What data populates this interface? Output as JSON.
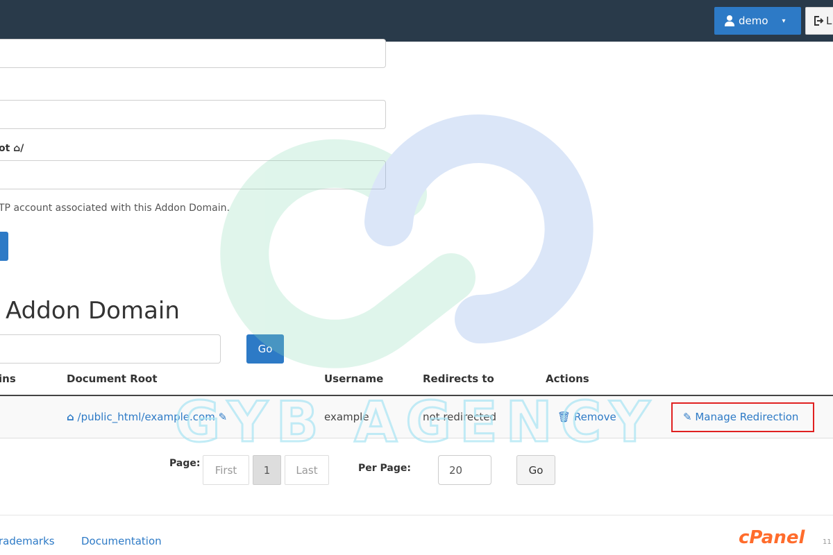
{
  "header": {
    "user_label": "demo",
    "user_caret": "▾",
    "logout_label": "L"
  },
  "form": {
    "doc_root_label": "ot",
    "doc_root_suffix": "/",
    "ftp_help": "TP account associated with this Addon Domain."
  },
  "section": {
    "title": "Addon Domain"
  },
  "search": {
    "go_label": "Go"
  },
  "table": {
    "headers": [
      "ins",
      "Document Root",
      "Username",
      "Redirects to",
      "Actions"
    ],
    "row": {
      "document_root": "/public_html/example.com",
      "username": "example",
      "redirects_to": "not redirected",
      "remove_label": "Remove",
      "manage_label": "Manage Redirection"
    }
  },
  "pagination": {
    "page_label": "Page:",
    "first_label": "First",
    "current_page": "1",
    "last_label": "Last",
    "per_page_label": "Per Page:",
    "per_page_value": "20",
    "go_label": "Go"
  },
  "footer": {
    "trademarks_label": "rademarks",
    "documentation_label": "Documentation",
    "logo_text": "cPanel",
    "version": "11"
  },
  "watermark": {
    "text": "GYB AGENCY"
  },
  "colors": {
    "topbar": "#293a4a",
    "primary": "#2d7ac6",
    "highlight": "#e02020",
    "cpanel_orange": "#ff6c2c"
  }
}
